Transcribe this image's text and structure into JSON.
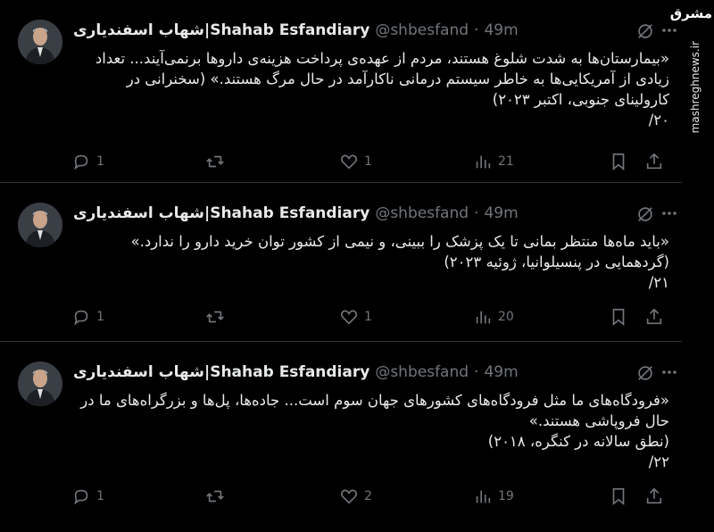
{
  "watermark": {
    "logo": "مشرق",
    "site": "mashreghnews.ir"
  },
  "tweets": [
    {
      "display_name": "شهاب اسفندیاری|Shahab Esfandiary",
      "handle": "@shbesfand",
      "sep": "·",
      "time": "49m",
      "text": "«بیمارستان‌ها به شدت شلوغ هستند، مردم از عهده‌ی پرداخت هزینه‌ی داروها برنمی‌آیند... تعداد زیادی از آمریکایی‌ها به خاطر سیستم درمانی ناکارآمد در حال مرگ هستند.» (سخنرانی در کارولینای جنوبی، اکتبر ۲۰۲۳)\n۲۰/",
      "replies": "1",
      "reposts": "",
      "likes": "1",
      "views": "21"
    },
    {
      "display_name": "شهاب اسفندیاری|Shahab Esfandiary",
      "handle": "@shbesfand",
      "sep": "·",
      "time": "49m",
      "text": "«باید ماه‌ها منتظر بمانی تا یک پزشک را ببینی، و نیمی از کشور توان خرید دارو را ندارد.» (گردهمایی در پنسیلوانیا، ژوئیه ۲۰۲۳)\n۲۱/",
      "replies": "1",
      "reposts": "",
      "likes": "1",
      "views": "20"
    },
    {
      "display_name": "شهاب اسفندیاری|Shahab Esfandiary",
      "handle": "@shbesfand",
      "sep": "·",
      "time": "49m",
      "text": "«فرودگاه‌های ما مثل فرودگاه‌های کشورهای جهان سوم است... جاده‌ها، پل‌ها و بزرگراه‌های ما در حال فروپاشی هستند.»\n(نطق سالانه در کنگره، ۲۰۱۸)\n۲۲/",
      "replies": "1",
      "reposts": "",
      "likes": "2",
      "views": "19"
    }
  ]
}
